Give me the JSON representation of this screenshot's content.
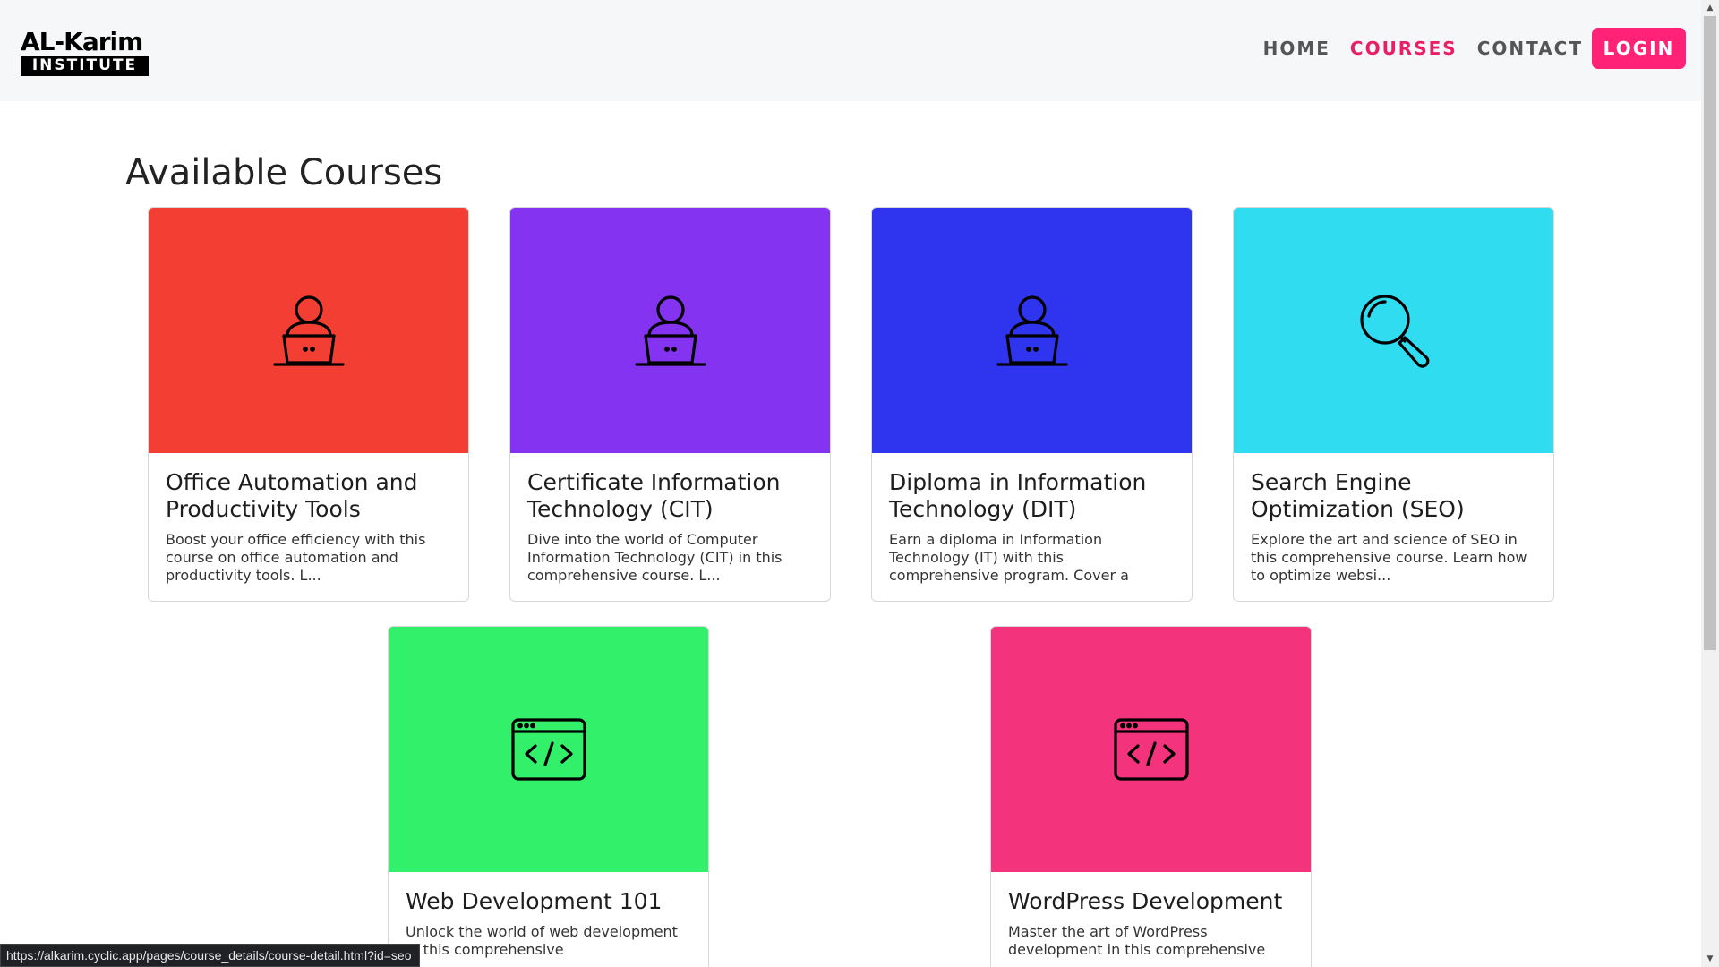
{
  "header": {
    "logo_top": "AL-Karim",
    "logo_bottom": "INSTITUTE",
    "nav": {
      "home": "HOME",
      "courses": "COURSES",
      "contact": "CONTACT",
      "login": "LOGIN"
    }
  },
  "main": {
    "title": "Available Courses",
    "courses": [
      {
        "title": "Office Automation and Productivity Tools",
        "description": "Boost your office efficiency with this course on office automation and productivity tools. L...",
        "color": "#f33e33",
        "icon": "person-laptop-icon"
      },
      {
        "title": "Certificate Information Technology (CIT)",
        "description": "Dive into the world of Computer Information Technology (CIT) in this comprehensive course. L...",
        "color": "#8433f0",
        "icon": "person-laptop-icon"
      },
      {
        "title": "Diploma in Information Technology (DIT)",
        "description": "Earn a diploma in Information Technology (IT) with this comprehensive program. Cover a",
        "color": "#2f34ef",
        "icon": "person-laptop-icon"
      },
      {
        "title": "Search Engine Optimization (SEO)",
        "description": "Explore the art and science of SEO in this comprehensive course. Learn how to optimize websi...",
        "color": "#30dcf0",
        "icon": "magnifier-icon"
      },
      {
        "title": "Web Development 101",
        "description": "Unlock the world of web development in this comprehensive",
        "color": "#33f06b",
        "icon": "code-window-icon"
      },
      {
        "title": "WordPress Development",
        "description": "Master the art of WordPress development in this comprehensive",
        "color": "#f3337b",
        "icon": "code-window-icon"
      }
    ]
  },
  "status_bar": {
    "url": "https://alkarim.cyclic.app/pages/course_details/course-detail.html?id=seo"
  }
}
